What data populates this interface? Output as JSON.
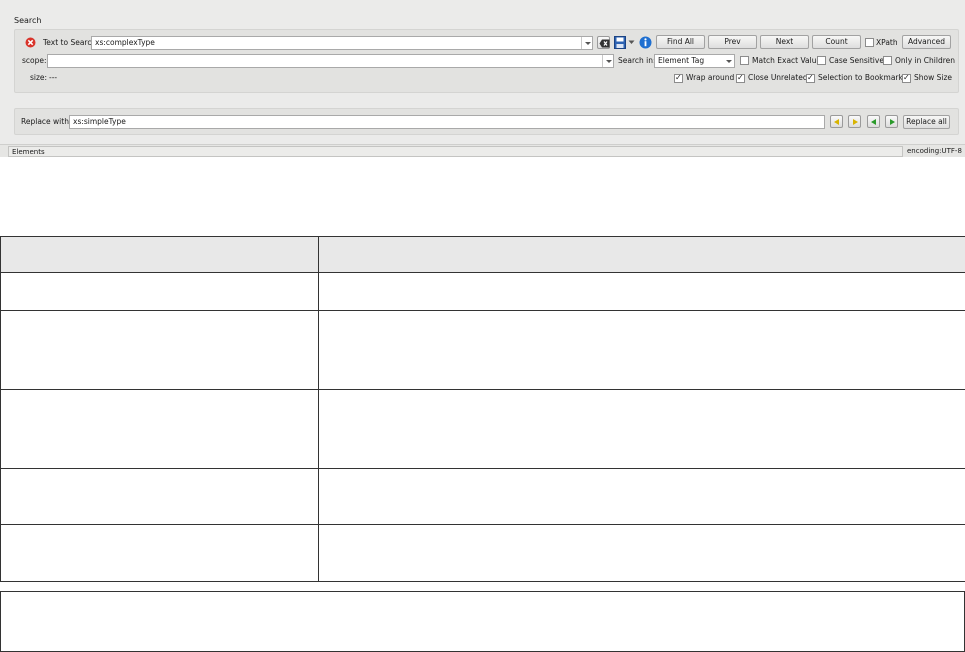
{
  "panel": {
    "title": "Search",
    "text_to_search_label": "Text to Search",
    "search_value": "xs:complexType",
    "scope_label": "scope:",
    "scope_value": "",
    "size_label": "size:",
    "size_value": "---",
    "search_in_label": "Search in:",
    "search_in_value": "Element Tag",
    "buttons": {
      "find_all": "Find All",
      "prev": "Prev",
      "next": "Next",
      "count": "Count",
      "advanced": "Advanced"
    },
    "options": {
      "xpath": {
        "label": "XPath",
        "checked": false
      },
      "match_exact": {
        "label": "Match Exact Value",
        "checked": false
      },
      "case_sensitive": {
        "label": "Case Sensitive",
        "checked": false
      },
      "only_children": {
        "label": "Only in Children",
        "checked": false
      },
      "wrap_around": {
        "label": "Wrap around",
        "checked": true
      },
      "close_unrelated": {
        "label": "Close Unrelated",
        "checked": true
      },
      "selection_bookmarks": {
        "label": "Selection to Bookmarks",
        "checked": true
      },
      "show_size": {
        "label": "Show Size",
        "checked": true
      }
    },
    "replace_label": "Replace with:",
    "replace_value": "xs:simpleType",
    "replace_all": "Replace all"
  },
  "status": {
    "elements_tab": "Elements",
    "encoding": "encoding:UTF-8"
  },
  "colors": {
    "error_red": "#d9342b",
    "info_blue": "#1f6fd0",
    "nav_yellow": "#d8b400",
    "nav_green": "#2a9a2a"
  }
}
